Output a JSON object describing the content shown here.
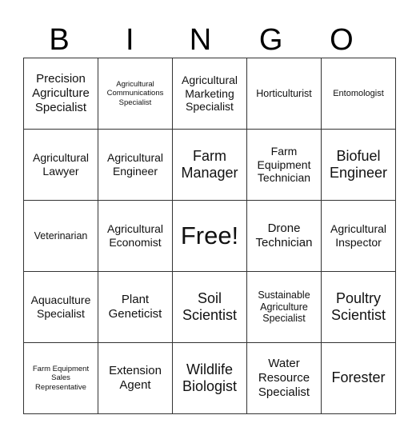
{
  "header": [
    "B",
    "I",
    "N",
    "G",
    "O"
  ],
  "rows": [
    [
      "Precision Agriculture Specialist",
      "Agricultural Communications Specialist",
      "Agricultural Marketing Specialist",
      "Horticulturist",
      "Entomologist"
    ],
    [
      "Agricultural Lawyer",
      "Agricultural Engineer",
      "Farm Manager",
      "Farm Equipment Technician",
      "Biofuel Engineer"
    ],
    [
      "Veterinarian",
      "Agricultural Economist",
      "Free!",
      "Drone Technician",
      "Agricultural Inspector"
    ],
    [
      "Aquaculture Specialist",
      "Plant Geneticist",
      "Soil Scientist",
      "Sustainable Agriculture Specialist",
      "Poultry Scientist"
    ],
    [
      "Farm Equipment Sales Representative",
      "Extension Agent",
      "Wildlife Biologist",
      "Water Resource Specialist",
      "Forester"
    ]
  ]
}
